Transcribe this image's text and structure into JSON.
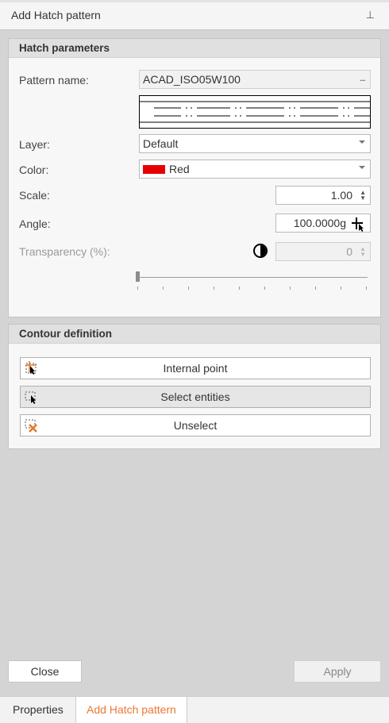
{
  "window": {
    "title": "Add Hatch pattern",
    "pin_icon": "pin-icon"
  },
  "hatch": {
    "header": "Hatch parameters",
    "pattern_name": {
      "label": "Pattern name:",
      "value": "ACAD_ISO05W100",
      "more": "..."
    },
    "layer": {
      "label": "Layer:",
      "value": "Default"
    },
    "color": {
      "label": "Color:",
      "value": "Red",
      "swatch": "#e60000"
    },
    "scale": {
      "label": "Scale:",
      "value": "1.00"
    },
    "angle": {
      "label": "Angle:",
      "value": "100.0000g"
    },
    "transparency": {
      "label": "Transparency (%):",
      "value": "0",
      "slider_position": 0
    }
  },
  "contour": {
    "header": "Contour definition",
    "internal_point": "Internal point",
    "select_entities": "Select entities",
    "unselect": "Unselect"
  },
  "buttons": {
    "close": "Close",
    "apply": "Apply"
  },
  "tabs": [
    {
      "label": "Properties",
      "active": false
    },
    {
      "label": "Add Hatch pattern",
      "active": true
    }
  ],
  "colors": {
    "accent": "#ee7733",
    "swatch_red": "#e60000"
  }
}
